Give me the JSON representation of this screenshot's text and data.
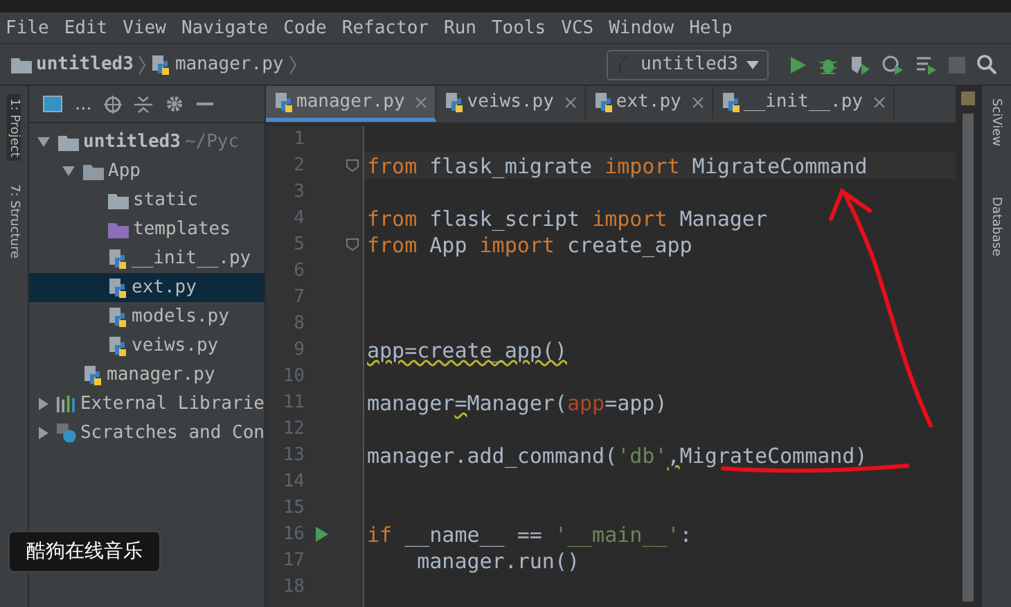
{
  "menu": [
    "File",
    "Edit",
    "View",
    "Navigate",
    "Code",
    "Refactor",
    "Run",
    "Tools",
    "VCS",
    "Window",
    "Help"
  ],
  "breadcrumbs": [
    {
      "label": "untitled3",
      "kind": "folder"
    },
    {
      "label": "manager.py",
      "kind": "py"
    }
  ],
  "run_config": {
    "label": "untitled3"
  },
  "left_strip": [
    "1: Project",
    "7: Structure"
  ],
  "right_strip": [
    "SciView",
    "Database"
  ],
  "project_panel": {
    "view_label": "...",
    "tree": [
      {
        "label": "untitled3",
        "hint": " ~/Pyc",
        "kind": "root",
        "expanded": true,
        "selected": false,
        "children": [
          {
            "label": "App",
            "kind": "package",
            "expanded": true,
            "selected": false,
            "children": [
              {
                "label": "static",
                "kind": "folder",
                "selected": false
              },
              {
                "label": "templates",
                "kind": "templates",
                "selected": false
              },
              {
                "label": "__init__.py",
                "kind": "py",
                "selected": false
              },
              {
                "label": "ext.py",
                "kind": "py",
                "selected": true
              },
              {
                "label": "models.py",
                "kind": "py",
                "selected": false
              },
              {
                "label": "veiws.py",
                "kind": "py",
                "selected": false
              }
            ]
          },
          {
            "label": "manager.py",
            "kind": "py",
            "selected": false
          }
        ]
      },
      {
        "label": "External Librarie",
        "kind": "library",
        "expanded": false,
        "selected": false
      },
      {
        "label": "Scratches and Con",
        "kind": "scratches",
        "expanded": false,
        "selected": false
      }
    ]
  },
  "tabs": [
    {
      "label": "manager.py",
      "selected": true
    },
    {
      "label": "veiws.py",
      "selected": false
    },
    {
      "label": "ext.py",
      "selected": false
    },
    {
      "label": "__init__.py",
      "selected": false
    }
  ],
  "editor": {
    "lines": [
      {
        "n": "1"
      },
      {
        "n": "2",
        "current": true,
        "fold": true,
        "tokens": [
          {
            "t": "from",
            "kind": "keyword"
          },
          {
            "t": " flask_migrate ",
            "kind": "plain"
          },
          {
            "t": "import",
            "kind": "keyword"
          },
          {
            "t": " MigrateCommand",
            "kind": "plain"
          }
        ]
      },
      {
        "n": "3"
      },
      {
        "n": "4",
        "tokens": [
          {
            "t": "from",
            "kind": "keyword"
          },
          {
            "t": " flask_script ",
            "kind": "plain"
          },
          {
            "t": "import",
            "kind": "keyword"
          },
          {
            "t": " Manager",
            "kind": "plain"
          }
        ]
      },
      {
        "n": "5",
        "fold": true,
        "tokens": [
          {
            "t": "from",
            "kind": "keyword"
          },
          {
            "t": " App ",
            "kind": "plain"
          },
          {
            "t": "import",
            "kind": "keyword"
          },
          {
            "t": " create_app",
            "kind": "plain"
          }
        ]
      },
      {
        "n": "6"
      },
      {
        "n": "7"
      },
      {
        "n": "8"
      },
      {
        "n": "9",
        "tokens": [
          {
            "t": "app=create_app()",
            "kind": "warning"
          }
        ]
      },
      {
        "n": "10"
      },
      {
        "n": "11",
        "tokens": [
          {
            "t": "manager",
            "kind": "plain"
          },
          {
            "t": "=",
            "kind": "warning"
          },
          {
            "t": "Manager(",
            "kind": "plain"
          },
          {
            "t": "app",
            "kind": "param"
          },
          {
            "t": "=app)",
            "kind": "plain"
          }
        ]
      },
      {
        "n": "12"
      },
      {
        "n": "13",
        "tokens": [
          {
            "t": "manager.add_command(",
            "kind": "plain"
          },
          {
            "t": "'db'",
            "kind": "string"
          },
          {
            "t": ",",
            "kind": "warning"
          },
          {
            "t": "MigrateCommand)",
            "kind": "plain"
          }
        ]
      },
      {
        "n": "14"
      },
      {
        "n": "15"
      },
      {
        "n": "16",
        "run": true,
        "tokens": [
          {
            "t": "if",
            "kind": "keyword"
          },
          {
            "t": " __name__ == ",
            "kind": "plain"
          },
          {
            "t": "'__main__'",
            "kind": "string"
          },
          {
            "t": ":",
            "kind": "plain"
          }
        ]
      },
      {
        "n": "17",
        "tokens": [
          {
            "t": "    manager.run()",
            "kind": "plain"
          }
        ]
      },
      {
        "n": "18"
      }
    ]
  },
  "tooltip": {
    "text": "酷狗在线音乐"
  }
}
